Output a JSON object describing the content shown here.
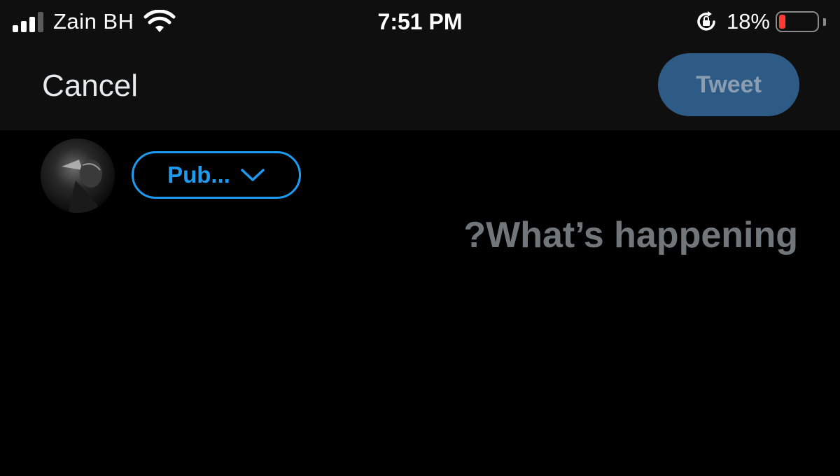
{
  "status_bar": {
    "carrier": "Zain BH",
    "time": "7:51 PM",
    "battery_percent": "18%",
    "battery_level": 0.18,
    "signal_bars": 3,
    "icons": [
      "signal-icon",
      "wifi-icon",
      "orientation-lock-icon",
      "battery-icon"
    ]
  },
  "nav": {
    "cancel_label": "Cancel",
    "tweet_label": "Tweet"
  },
  "compose": {
    "audience_label": "Pub...",
    "placeholder": "?What’s happening"
  },
  "colors": {
    "accent": "#1d9bf0",
    "tweet_button_disabled": "#2e5b86",
    "placeholder": "#71767b",
    "battery_low": "#ff3b30"
  }
}
